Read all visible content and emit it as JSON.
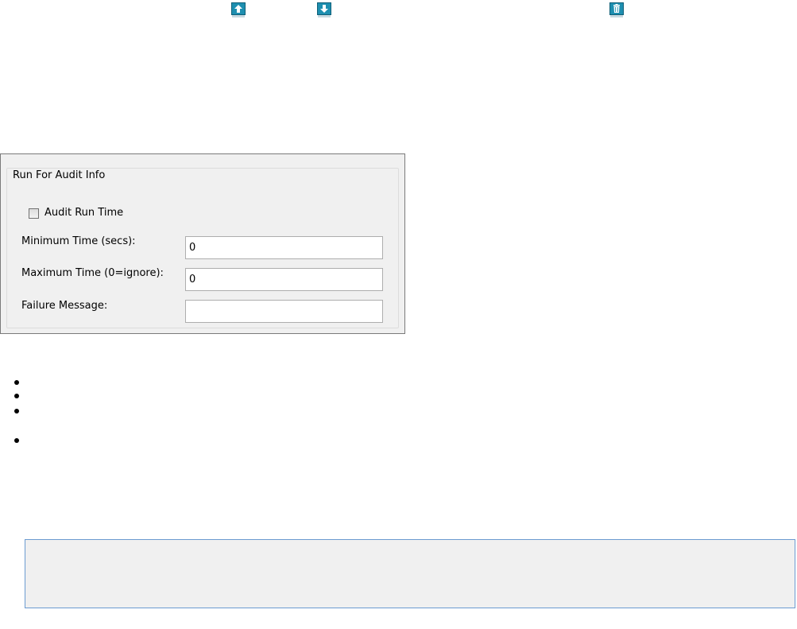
{
  "toolbar": {
    "icons": [
      {
        "name": "move-up-icon",
        "color": "#1e8fb0"
      },
      {
        "name": "move-down-icon",
        "color": "#1e8fb0"
      },
      {
        "name": "delete-icon",
        "color": "#1e8fb0"
      }
    ]
  },
  "dialog": {
    "group_title": "Run For Audit Info",
    "audit_run_time": {
      "label": "Audit Run Time",
      "checked": false
    },
    "fields": {
      "minimum_time": {
        "label": "Minimum Time (secs):",
        "value": "0"
      },
      "maximum_time": {
        "label": "Maximum Time (0=ignore):",
        "value": "0"
      },
      "failure_message": {
        "label": "Failure Message:",
        "value": ""
      }
    }
  },
  "colors": {
    "panel_bg": "#f0f0f0",
    "panel_border": "#7a7a7a",
    "info_border": "#6b9bd1",
    "icon_teal": "#1e8fb0"
  }
}
